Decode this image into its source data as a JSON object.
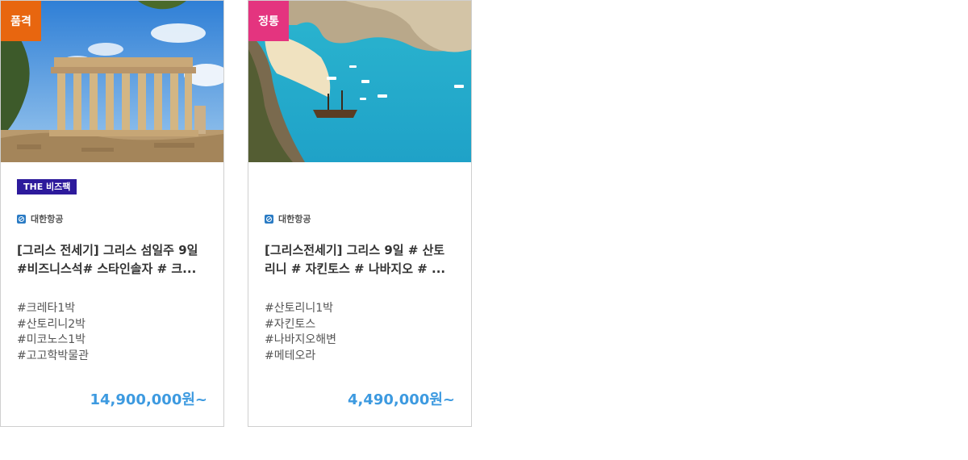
{
  "colors": {
    "price": "#3d9ae0",
    "badge_품격": "#e8660f",
    "badge_정통": "#e4347f",
    "biz_tag_bg": "#2d1a9c"
  },
  "cards": [
    {
      "flag": "품격",
      "flag_color": "#e8660f",
      "biz_tag": "THE 비즈팩",
      "airline": "대한항공",
      "title_line1": "[그리스 전세기] 그리스 섬일주 9일",
      "title_line2": "#비즈니스석# 스타인솔자 # 크...",
      "tags": [
        "#크레타1박",
        "#산토리니2박",
        "#미코노스1박",
        "#고고학박물관"
      ],
      "price": "14,900,000원~"
    },
    {
      "flag": "정통",
      "flag_color": "#e4347f",
      "biz_tag": "",
      "airline": "대한항공",
      "title_line1": "[그리스전세기] 그리스 9일 # 산토",
      "title_line2": "리니 # 자킨토스 # 나바지오 # ...",
      "tags": [
        "#산토리니1박",
        "#자킨토스",
        "#나바지오해변",
        "#메테오라"
      ],
      "price": "4,490,000원~"
    }
  ]
}
